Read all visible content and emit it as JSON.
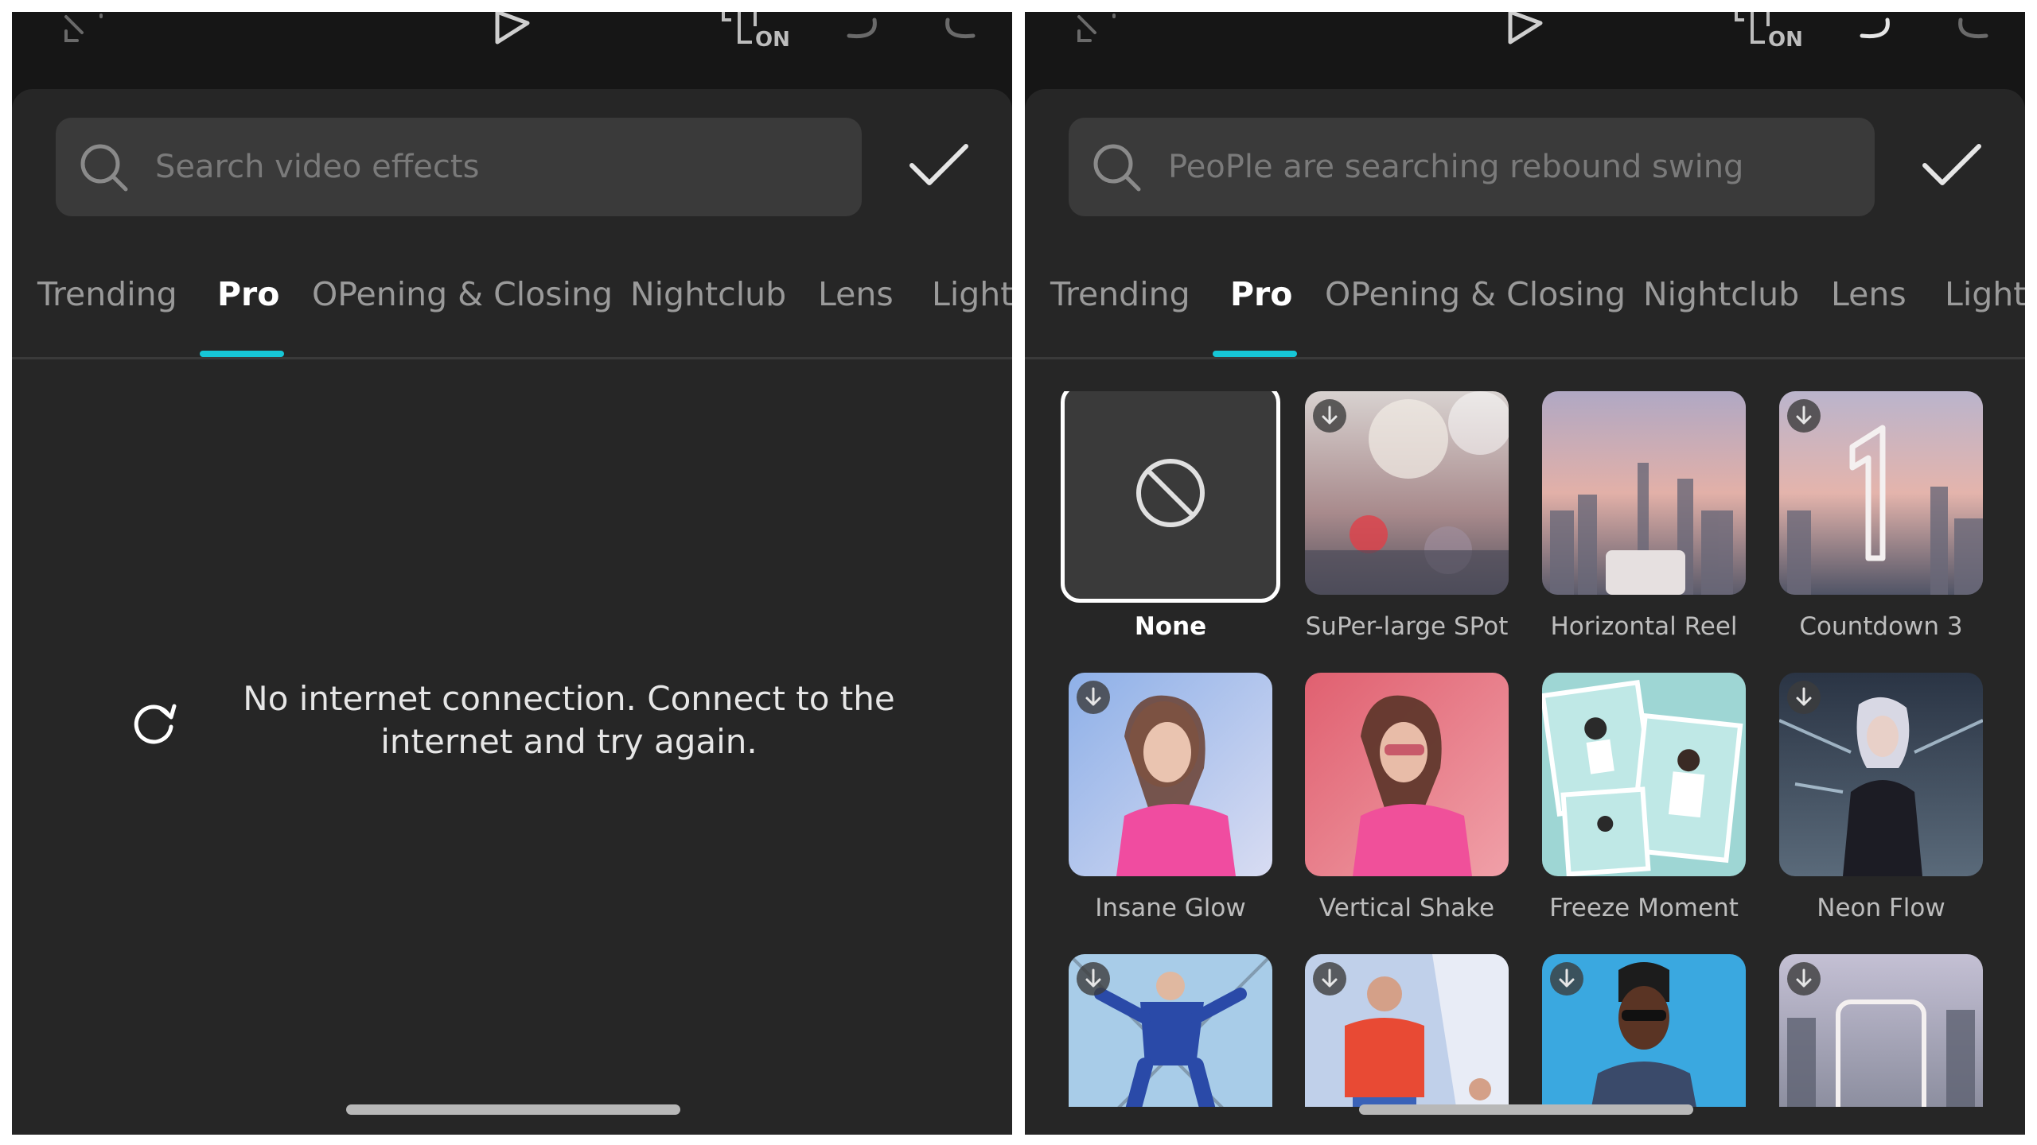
{
  "left_panel": {
    "search_placeholder": "Search video effects",
    "tabs": [
      "Trending",
      "Pro",
      "OPening & Closing",
      "Nightclub",
      "Lens",
      "Light"
    ],
    "active_tab": "Pro",
    "offline_message_line1": "No internet connection. Connect to the",
    "offline_message_line2": "internet and try again."
  },
  "right_panel": {
    "search_placeholder": "PeoPle are searching rebound swing",
    "tabs": [
      "Trending",
      "Pro",
      "OPening & Closing",
      "Nightclub",
      "Lens",
      "Light"
    ],
    "active_tab": "Pro",
    "effects": [
      {
        "label": "None",
        "selected": true,
        "download": false
      },
      {
        "label": "SuPer-large SPot",
        "selected": false,
        "download": true
      },
      {
        "label": "Horizontal Reel",
        "selected": false,
        "download": false
      },
      {
        "label": "Countdown 3",
        "selected": false,
        "download": true
      },
      {
        "label": "Insane Glow",
        "selected": false,
        "download": true
      },
      {
        "label": "Vertical Shake",
        "selected": false,
        "download": false
      },
      {
        "label": "Freeze Moment",
        "selected": false,
        "download": false
      },
      {
        "label": "Neon Flow",
        "selected": false,
        "download": true
      },
      {
        "label": "",
        "selected": false,
        "download": true
      },
      {
        "label": "",
        "selected": false,
        "download": true
      },
      {
        "label": "",
        "selected": false,
        "download": true
      },
      {
        "label": "",
        "selected": false,
        "download": true
      }
    ]
  },
  "topbar": {
    "clip_badge": "ON",
    "icons": [
      "expand-icon",
      "play-icon",
      "clip-on-icon",
      "undo-icon",
      "redo-icon"
    ]
  },
  "colors": {
    "accent": "#16c6d6",
    "background": "#161616",
    "sheet": "#262626",
    "search_bg": "#3a3a3a"
  }
}
